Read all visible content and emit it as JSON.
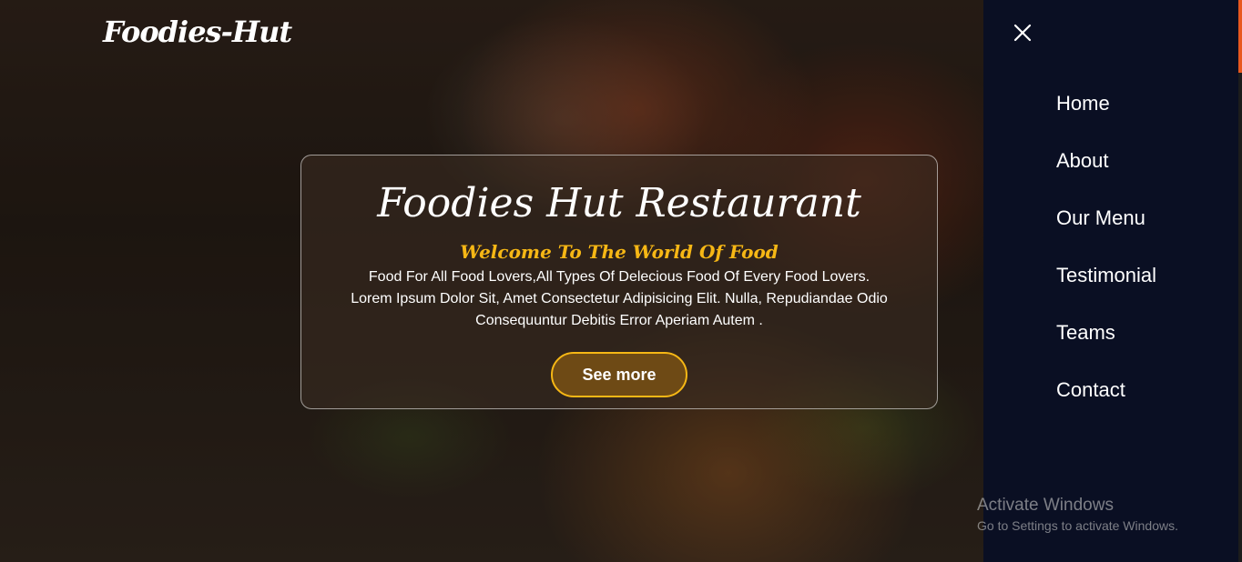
{
  "header": {
    "logo": "Foodies-Hut"
  },
  "hero": {
    "title": "Foodies Hut Restaurant",
    "subtitle": "Welcome To The World Of Food",
    "description_line1": "Food For All Food Lovers,All Types Of Delecious Food Of Every Food Lovers.",
    "description_line2": "Lorem Ipsum Dolor Sit, Amet Consectetur Adipisicing Elit. Nulla, Repudiandae Odio",
    "description_line3": "Consequuntur Debitis Error Aperiam Autem .",
    "button_label": "See more"
  },
  "sidenav": {
    "close_icon": "close-icon",
    "items": [
      {
        "label": "Home"
      },
      {
        "label": "About"
      },
      {
        "label": "Our Menu"
      },
      {
        "label": "Testimonial"
      },
      {
        "label": "Teams"
      },
      {
        "label": "Contact"
      }
    ]
  },
  "watermark": {
    "line1": "Activate Windows",
    "line2": "Go to Settings to activate Windows."
  },
  "colors": {
    "accent": "#f6b715",
    "sidenav_bg": "#0a0f23",
    "scroll_thumb": "#e8581e"
  }
}
